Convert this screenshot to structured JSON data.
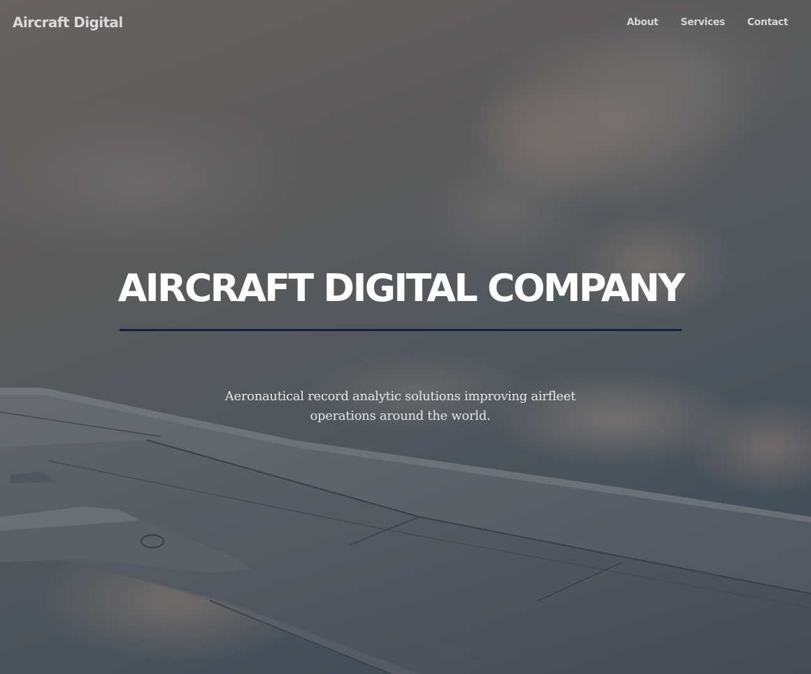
{
  "navbar": {
    "brand": "Aircraft Digital",
    "links": [
      {
        "label": "About"
      },
      {
        "label": "Services"
      },
      {
        "label": "Contact"
      }
    ]
  },
  "hero": {
    "title": "AIRCRAFT DIGITAL COMPANY",
    "subtitle": "Aeronautical record analytic solutions improving airfleet operations around the world.",
    "background_image": "airplane-wing-above-clouds"
  },
  "colors": {
    "divider": "#0f1f3d",
    "title": "#ffffff",
    "nav_text": "#d4d5d8",
    "brand_text": "#d9d9db",
    "subtitle": "#e6e6e6"
  }
}
